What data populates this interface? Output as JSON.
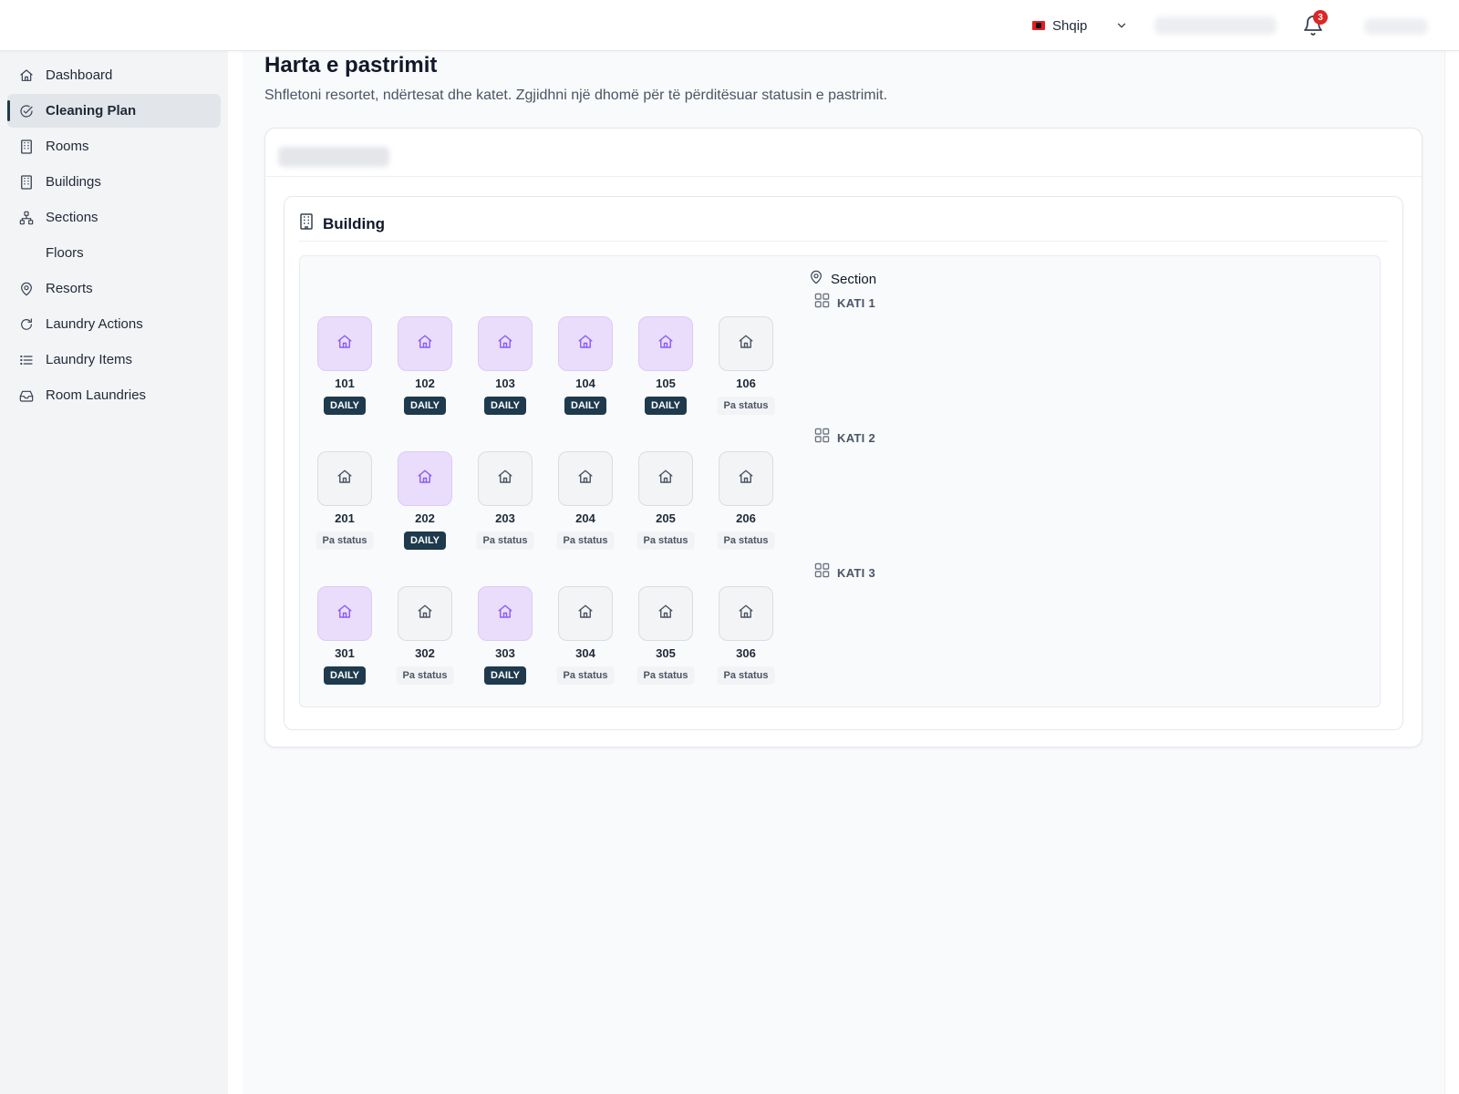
{
  "topbar": {
    "language": "Shqip",
    "notifications_count": "3"
  },
  "sidebar": {
    "items": [
      {
        "label": "Dashboard",
        "icon": "home-icon",
        "active": false
      },
      {
        "label": "Cleaning Plan",
        "icon": "check-circle-icon",
        "active": true
      },
      {
        "label": "Rooms",
        "icon": "building-icon",
        "active": false
      },
      {
        "label": "Buildings",
        "icon": "building-icon",
        "active": false
      },
      {
        "label": "Sections",
        "icon": "sitemap-icon",
        "active": false
      },
      {
        "label": "Floors",
        "icon": "",
        "active": false
      },
      {
        "label": "Resorts",
        "icon": "map-pin-icon",
        "active": false
      },
      {
        "label": "Laundry Actions",
        "icon": "refresh-icon",
        "active": false
      },
      {
        "label": "Laundry Items",
        "icon": "list-icon",
        "active": false
      },
      {
        "label": "Room Laundries",
        "icon": "inbox-icon",
        "active": false
      }
    ]
  },
  "main": {
    "title": "Harta e pastrimit",
    "subtitle": "Shfletoni resortet, ndërtesat dhe katet. Zgjidhni një dhomë për të përditësuar statusin e pastrimit.",
    "building": {
      "title": "Building",
      "section": {
        "title": "Section",
        "floors": [
          {
            "label": "KATI 1",
            "rooms": [
              {
                "number": "101",
                "status": "DAILY",
                "daily": true
              },
              {
                "number": "102",
                "status": "DAILY",
                "daily": true
              },
              {
                "number": "103",
                "status": "DAILY",
                "daily": true
              },
              {
                "number": "104",
                "status": "DAILY",
                "daily": true
              },
              {
                "number": "105",
                "status": "DAILY",
                "daily": true
              },
              {
                "number": "106",
                "status": "Pa status",
                "daily": false
              }
            ]
          },
          {
            "label": "KATI 2",
            "rooms": [
              {
                "number": "201",
                "status": "Pa status",
                "daily": false
              },
              {
                "number": "202",
                "status": "DAILY",
                "daily": true
              },
              {
                "number": "203",
                "status": "Pa status",
                "daily": false
              },
              {
                "number": "204",
                "status": "Pa status",
                "daily": false
              },
              {
                "number": "205",
                "status": "Pa status",
                "daily": false
              },
              {
                "number": "206",
                "status": "Pa status",
                "daily": false
              }
            ]
          },
          {
            "label": "KATI 3",
            "rooms": [
              {
                "number": "301",
                "status": "DAILY",
                "daily": true
              },
              {
                "number": "302",
                "status": "Pa status",
                "daily": false
              },
              {
                "number": "303",
                "status": "DAILY",
                "daily": true
              },
              {
                "number": "304",
                "status": "Pa status",
                "daily": false
              },
              {
                "number": "305",
                "status": "Pa status",
                "daily": false
              },
              {
                "number": "306",
                "status": "Pa status",
                "daily": false
              }
            ]
          }
        ]
      }
    }
  },
  "colors": {
    "accent": "#1e3a4c",
    "daily_tile": "#e9ddfb",
    "daily_icon": "#8b5cf6",
    "none_icon": "#4b5563",
    "badge": "#dc2626"
  }
}
